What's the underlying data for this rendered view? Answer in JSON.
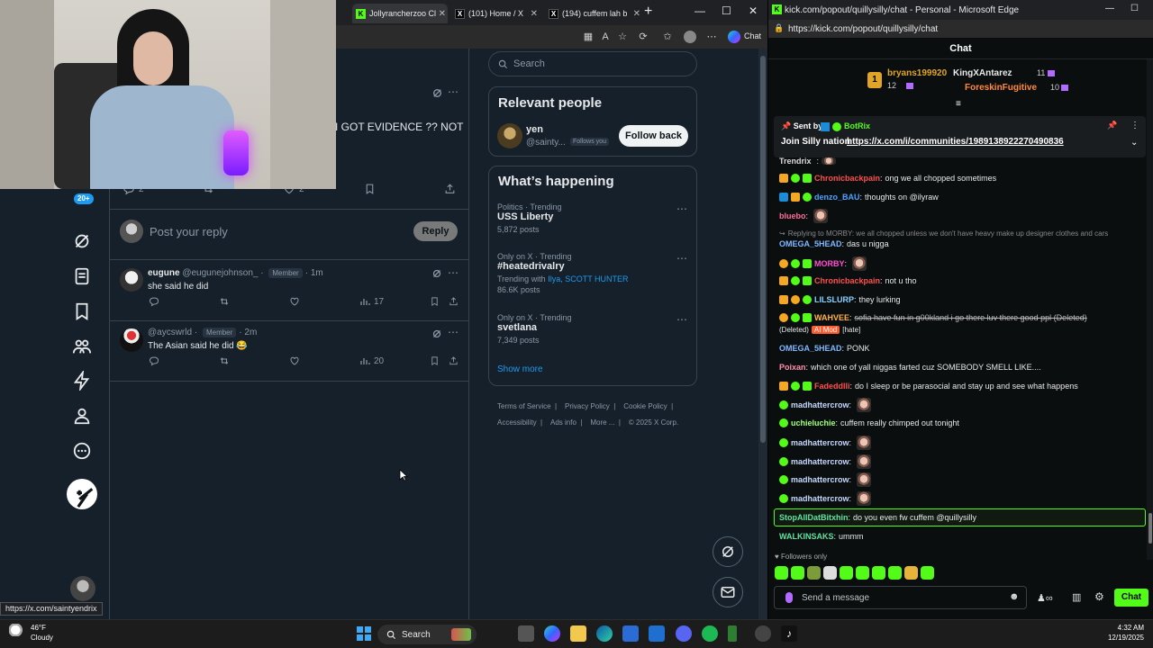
{
  "left_browser": {
    "tabs": [
      {
        "label": "Jollyrancherzoo Cl",
        "icon": "kick"
      },
      {
        "label": "(101) Home / X",
        "icon": "x"
      },
      {
        "label": "(194) cuffem lah b",
        "icon": "x"
      }
    ],
    "new_tab": "+",
    "url_hover": "https://x.com/saintyendrix"
  },
  "tweet": {
    "text_fragment": "I GOT EVIDENCE ?? NOT",
    "reply_count": "2",
    "like_count": "2",
    "reply_placeholder": "Post your reply",
    "reply_button": "Reply"
  },
  "replies": [
    {
      "name": "eugune",
      "handle": "@eugunejohnson_",
      "badge": "Member",
      "time": "1m",
      "text": "she said he did",
      "views": "17"
    },
    {
      "name": "",
      "handle": "@aycswrld",
      "badge": "Member",
      "time": "2m",
      "text": "The Asian said he did 😂",
      "views": "20"
    }
  ],
  "nav": {
    "badge": "20+"
  },
  "search": {
    "placeholder": "Search"
  },
  "relevant_people": {
    "title": "Relevant people",
    "person": {
      "name": "yen",
      "handle": "@sainty...",
      "note": "Follows you"
    },
    "follow_button": "Follow back"
  },
  "whats_happening": {
    "title": "What’s happening",
    "trends": [
      {
        "context": "Politics · Trending",
        "name": "USS Liberty",
        "count": "5,872 posts"
      },
      {
        "context": "Only on X · Trending",
        "name": "#heatedrivalry",
        "with_label": "Trending with",
        "with_names": "Ilya, SCOTT HUNTER",
        "count": "86.6K posts"
      },
      {
        "context": "Only on X · Trending",
        "name": "svetlana",
        "count": "7,349 posts"
      }
    ],
    "show_more": "Show more"
  },
  "footer": {
    "links": [
      "Terms of Service",
      "Privacy Policy",
      "Cookie Policy",
      "Accessibility",
      "Ads info",
      "More ...",
      "© 2025 X Corp."
    ]
  },
  "right_browser": {
    "title": "kick.com/popout/quillysilly/chat - Personal - Microsoft Edge",
    "url": "https://kick.com/popout/quillysilly/chat"
  },
  "chat": {
    "header": "Chat",
    "gifters": [
      {
        "name": "bryans199920",
        "count": "12"
      },
      {
        "name": "KingXAntarez",
        "count": "11"
      },
      {
        "name": "ForeskinFugitive",
        "count": "10"
      }
    ],
    "pinned": {
      "sent_by_label": "Sent by",
      "sender": "BotRix",
      "text": "Join Silly nation",
      "link": "https://x.com/i/communities/1989138922270490836"
    },
    "messages": [
      {
        "user": "Trendrix",
        "text": ""
      },
      {
        "user": "Chronicbackpain",
        "text": "ong we all chopped sometimes"
      },
      {
        "user": "denzo_BAU",
        "text": "thoughts on @ilyraw"
      },
      {
        "user": "bluebo",
        "text": ""
      },
      {
        "user": "OMEGA_5HEAD",
        "text": "das u nigga",
        "reply_to": "Replying to MORBY: we all chopped unless we don't have heavy make up designer clothes and cars"
      },
      {
        "user": "MORBY",
        "text": ""
      },
      {
        "user": "Chronicbackpain",
        "text": "not u tho"
      },
      {
        "user": "LILSLURP",
        "text": "they lurking"
      },
      {
        "user": "WAHVEE",
        "text": "sofia have fun in g00kland i go there luv there good ppl (Deleted)",
        "deleted_label": "(Deleted)",
        "mod_label": "AI Mod",
        "tag": "[hate]"
      },
      {
        "user": "OMEGA_5HEAD",
        "text": "PONK"
      },
      {
        "user": "Poixan",
        "text": "which one of yall niggas farted cuz SOMEBODY SMELL LIKE...."
      },
      {
        "user": "Fadeddlli",
        "text": "do I sleep or be parasocial and stay up and see what happens"
      },
      {
        "user": "madhattercrow",
        "text": ""
      },
      {
        "user": "uchieluchie",
        "text": "cuffem really chimped out tonight"
      },
      {
        "user": "madhattercrow",
        "text": ""
      },
      {
        "user": "madhattercrow",
        "text": ""
      },
      {
        "user": "madhattercrow",
        "text": ""
      },
      {
        "user": "madhattercrow",
        "text": ""
      },
      {
        "user": "StopAllDatBitxhin",
        "text": "do you even fw cuffem @quillysilly"
      },
      {
        "user": "WALKINSAKS",
        "text": "ummm"
      }
    ],
    "followers_only": "Followers only",
    "input_placeholder": "Send a message",
    "send_button": "Chat"
  },
  "taskbar": {
    "weather_temp": "46°F",
    "weather_desc": "Cloudy",
    "search_label": "Search",
    "time": "4:32 AM",
    "date": "12/19/2025"
  },
  "colors": {
    "x_bg": "#15202b",
    "kick_green": "#53fc18",
    "x_blue": "#1d9bf0"
  }
}
